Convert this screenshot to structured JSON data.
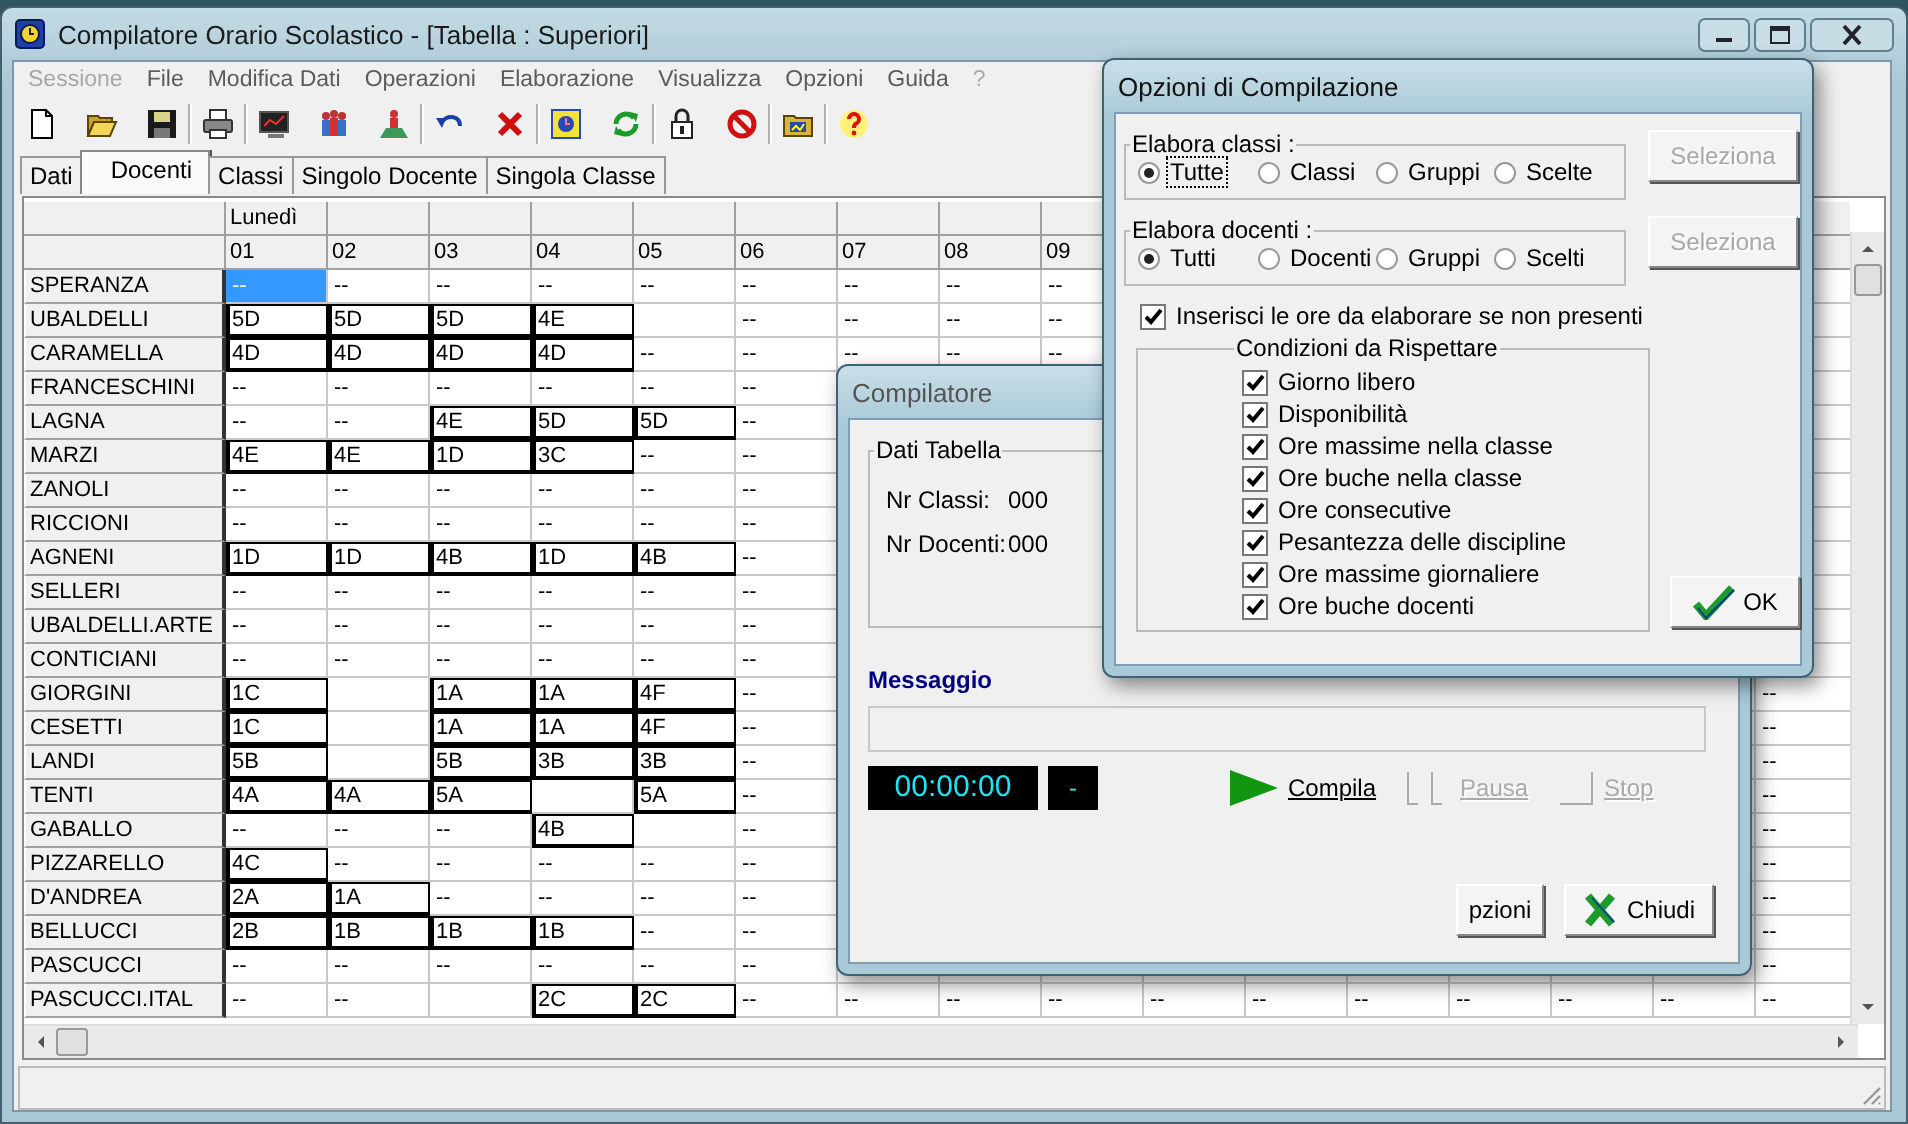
{
  "window": {
    "title": "Compilatore Orario Scolastico - [Tabella : Superiori]",
    "menu": [
      {
        "label": "Sessione",
        "disabled": true
      },
      {
        "label": "File",
        "disabled": false
      },
      {
        "label": "Modifica Dati",
        "disabled": false
      },
      {
        "label": "Operazioni",
        "disabled": false
      },
      {
        "label": "Elaborazione",
        "disabled": false
      },
      {
        "label": "Visualizza",
        "disabled": false
      },
      {
        "label": "Opzioni",
        "disabled": false
      },
      {
        "label": "Guida",
        "disabled": false
      },
      {
        "label": "?",
        "disabled": true
      }
    ],
    "tabs": [
      {
        "label": "Dati",
        "selected": false
      },
      {
        "label": "Docenti",
        "selected": true
      },
      {
        "label": "Classi",
        "selected": false
      },
      {
        "label": "Singolo Docente",
        "selected": false
      },
      {
        "label": "Singola Classe",
        "selected": false
      }
    ]
  },
  "grid": {
    "day": "Lunedì",
    "hours": [
      "01",
      "02",
      "03",
      "04",
      "05",
      "06",
      "07",
      "08",
      "09"
    ],
    "rows": [
      {
        "name": "SPERANZA",
        "cells": [
          {
            "text": "--",
            "boxed": false,
            "selected": true
          },
          {
            "text": "--",
            "boxed": false,
            "selected": false
          },
          {
            "text": "--",
            "boxed": false,
            "selected": false
          },
          {
            "text": "--",
            "boxed": false,
            "selected": false
          },
          {
            "text": "--",
            "boxed": false,
            "selected": false
          },
          {
            "text": "--",
            "boxed": false,
            "selected": false
          },
          {
            "text": "--",
            "boxed": false,
            "selected": false
          },
          {
            "text": "--",
            "boxed": false,
            "selected": false
          },
          {
            "text": "--",
            "boxed": false,
            "selected": false
          }
        ]
      },
      {
        "name": "UBALDELLI",
        "cells": [
          {
            "text": "5D",
            "boxed": true,
            "selected": false
          },
          {
            "text": "5D",
            "boxed": true,
            "selected": false
          },
          {
            "text": "5D",
            "boxed": true,
            "selected": false
          },
          {
            "text": "4E",
            "boxed": true,
            "selected": false
          },
          null,
          {
            "text": "--",
            "boxed": false,
            "selected": false
          },
          {
            "text": "--",
            "boxed": false,
            "selected": false
          },
          {
            "text": "--",
            "boxed": false,
            "selected": false
          },
          {
            "text": "--",
            "boxed": false,
            "selected": false
          }
        ]
      },
      {
        "name": "CARAMELLA",
        "cells": [
          {
            "text": "4D",
            "boxed": true,
            "selected": false
          },
          {
            "text": "4D",
            "boxed": true,
            "selected": false
          },
          {
            "text": "4D",
            "boxed": true,
            "selected": false
          },
          {
            "text": "4D",
            "boxed": true,
            "selected": false
          },
          {
            "text": "--",
            "boxed": false,
            "selected": false
          },
          {
            "text": "--",
            "boxed": false,
            "selected": false
          },
          {
            "text": "--",
            "boxed": false,
            "selected": false
          },
          {
            "text": "--",
            "boxed": false,
            "selected": false
          },
          {
            "text": "--",
            "boxed": false,
            "selected": false
          }
        ]
      },
      {
        "name": "FRANCESCHINI",
        "cells": [
          {
            "text": "--",
            "boxed": false,
            "selected": false
          },
          {
            "text": "--",
            "boxed": false,
            "selected": false
          },
          {
            "text": "--",
            "boxed": false,
            "selected": false
          },
          {
            "text": "--",
            "boxed": false,
            "selected": false
          },
          {
            "text": "--",
            "boxed": false,
            "selected": false
          },
          {
            "text": "--",
            "boxed": false,
            "selected": false
          }
        ]
      },
      {
        "name": "LAGNA",
        "cells": [
          {
            "text": "--",
            "boxed": false,
            "selected": false
          },
          {
            "text": "--",
            "boxed": false,
            "selected": false
          },
          {
            "text": "4E",
            "boxed": true,
            "selected": false
          },
          {
            "text": "5D",
            "boxed": true,
            "selected": false
          },
          {
            "text": "5D",
            "boxed": true,
            "selected": false
          },
          {
            "text": "--",
            "boxed": false,
            "selected": false
          }
        ]
      },
      {
        "name": "MARZI",
        "cells": [
          {
            "text": "4E",
            "boxed": true,
            "selected": false
          },
          {
            "text": "4E",
            "boxed": true,
            "selected": false
          },
          {
            "text": "1D",
            "boxed": true,
            "selected": false
          },
          {
            "text": "3C",
            "boxed": true,
            "selected": false
          },
          {
            "text": "--",
            "boxed": false,
            "selected": false
          },
          {
            "text": "--",
            "boxed": false,
            "selected": false
          }
        ]
      },
      {
        "name": "ZANOLI",
        "cells": [
          {
            "text": "--",
            "boxed": false,
            "selected": false
          },
          {
            "text": "--",
            "boxed": false,
            "selected": false
          },
          {
            "text": "--",
            "boxed": false,
            "selected": false
          },
          {
            "text": "--",
            "boxed": false,
            "selected": false
          },
          {
            "text": "--",
            "boxed": false,
            "selected": false
          },
          {
            "text": "--",
            "boxed": false,
            "selected": false
          }
        ]
      },
      {
        "name": "RICCIONI",
        "cells": [
          {
            "text": "--",
            "boxed": false,
            "selected": false
          },
          {
            "text": "--",
            "boxed": false,
            "selected": false
          },
          {
            "text": "--",
            "boxed": false,
            "selected": false
          },
          {
            "text": "--",
            "boxed": false,
            "selected": false
          },
          {
            "text": "--",
            "boxed": false,
            "selected": false
          },
          {
            "text": "--",
            "boxed": false,
            "selected": false
          }
        ]
      },
      {
        "name": "AGNENI",
        "cells": [
          {
            "text": "1D",
            "boxed": true,
            "selected": false
          },
          {
            "text": "1D",
            "boxed": true,
            "selected": false
          },
          {
            "text": "4B",
            "boxed": true,
            "selected": false
          },
          {
            "text": "1D",
            "boxed": true,
            "selected": false
          },
          {
            "text": "4B",
            "boxed": true,
            "selected": false
          },
          {
            "text": "--",
            "boxed": false,
            "selected": false
          }
        ]
      },
      {
        "name": "SELLERI",
        "cells": [
          {
            "text": "--",
            "boxed": false,
            "selected": false
          },
          {
            "text": "--",
            "boxed": false,
            "selected": false
          },
          {
            "text": "--",
            "boxed": false,
            "selected": false
          },
          {
            "text": "--",
            "boxed": false,
            "selected": false
          },
          {
            "text": "--",
            "boxed": false,
            "selected": false
          },
          {
            "text": "--",
            "boxed": false,
            "selected": false
          }
        ]
      },
      {
        "name": "UBALDELLI.ARTE",
        "cells": [
          {
            "text": "--",
            "boxed": false,
            "selected": false
          },
          {
            "text": "--",
            "boxed": false,
            "selected": false
          },
          {
            "text": "--",
            "boxed": false,
            "selected": false
          },
          {
            "text": "--",
            "boxed": false,
            "selected": false
          },
          {
            "text": "--",
            "boxed": false,
            "selected": false
          },
          {
            "text": "--",
            "boxed": false,
            "selected": false
          }
        ]
      },
      {
        "name": "CONTICIANI",
        "cells": [
          {
            "text": "--",
            "boxed": false,
            "selected": false
          },
          {
            "text": "--",
            "boxed": false,
            "selected": false
          },
          {
            "text": "--",
            "boxed": false,
            "selected": false
          },
          {
            "text": "--",
            "boxed": false,
            "selected": false
          },
          {
            "text": "--",
            "boxed": false,
            "selected": false
          },
          {
            "text": "--",
            "boxed": false,
            "selected": false
          }
        ]
      },
      {
        "name": "GIORGINI",
        "cells": [
          {
            "text": "1C",
            "boxed": true,
            "selected": false
          },
          null,
          {
            "text": "1A",
            "boxed": true,
            "selected": false
          },
          {
            "text": "1A",
            "boxed": true,
            "selected": false
          },
          {
            "text": "4F",
            "boxed": true,
            "selected": false
          },
          {
            "text": "--",
            "boxed": false,
            "selected": false
          },
          null,
          null,
          null,
          null,
          null,
          null,
          null,
          null,
          null,
          {
            "text": "--",
            "boxed": false,
            "selected": false
          }
        ]
      },
      {
        "name": "CESETTI",
        "cells": [
          {
            "text": "1C",
            "boxed": true,
            "selected": false
          },
          null,
          {
            "text": "1A",
            "boxed": true,
            "selected": false
          },
          {
            "text": "1A",
            "boxed": true,
            "selected": false
          },
          {
            "text": "4F",
            "boxed": true,
            "selected": false
          },
          {
            "text": "--",
            "boxed": false,
            "selected": false
          },
          null,
          null,
          null,
          null,
          null,
          null,
          null,
          null,
          null,
          {
            "text": "--",
            "boxed": false,
            "selected": false
          }
        ]
      },
      {
        "name": "LANDI",
        "cells": [
          {
            "text": "5B",
            "boxed": true,
            "selected": false
          },
          null,
          {
            "text": "5B",
            "boxed": true,
            "selected": false
          },
          {
            "text": "3B",
            "boxed": true,
            "selected": false
          },
          {
            "text": "3B",
            "boxed": true,
            "selected": false
          },
          {
            "text": "--",
            "boxed": false,
            "selected": false
          },
          null,
          null,
          null,
          null,
          null,
          null,
          null,
          null,
          null,
          {
            "text": "--",
            "boxed": false,
            "selected": false
          }
        ]
      },
      {
        "name": "TENTI",
        "cells": [
          {
            "text": "4A",
            "boxed": true,
            "selected": false
          },
          {
            "text": "4A",
            "boxed": true,
            "selected": false
          },
          {
            "text": "5A",
            "boxed": true,
            "selected": false
          },
          null,
          {
            "text": "5A",
            "boxed": true,
            "selected": false
          },
          {
            "text": "--",
            "boxed": false,
            "selected": false
          },
          null,
          null,
          null,
          null,
          null,
          null,
          null,
          null,
          null,
          {
            "text": "--",
            "boxed": false,
            "selected": false
          }
        ]
      },
      {
        "name": "GABALLO",
        "cells": [
          {
            "text": "--",
            "boxed": false,
            "selected": false
          },
          {
            "text": "--",
            "boxed": false,
            "selected": false
          },
          {
            "text": "--",
            "boxed": false,
            "selected": false
          },
          {
            "text": "4B",
            "boxed": true,
            "selected": false
          },
          null,
          {
            "text": "--",
            "boxed": false,
            "selected": false
          },
          null,
          null,
          null,
          null,
          null,
          null,
          null,
          null,
          null,
          {
            "text": "--",
            "boxed": false,
            "selected": false
          }
        ]
      },
      {
        "name": "PIZZARELLO",
        "cells": [
          {
            "text": "4C",
            "boxed": true,
            "selected": false
          },
          {
            "text": "--",
            "boxed": false,
            "selected": false
          },
          {
            "text": "--",
            "boxed": false,
            "selected": false
          },
          {
            "text": "--",
            "boxed": false,
            "selected": false
          },
          {
            "text": "--",
            "boxed": false,
            "selected": false
          },
          {
            "text": "--",
            "boxed": false,
            "selected": false
          },
          null,
          null,
          null,
          null,
          null,
          null,
          null,
          null,
          null,
          {
            "text": "--",
            "boxed": false,
            "selected": false
          }
        ]
      },
      {
        "name": "D'ANDREA",
        "cells": [
          {
            "text": "2A",
            "boxed": true,
            "selected": false
          },
          {
            "text": "1A",
            "boxed": true,
            "selected": false
          },
          {
            "text": "--",
            "boxed": false,
            "selected": false
          },
          {
            "text": "--",
            "boxed": false,
            "selected": false
          },
          {
            "text": "--",
            "boxed": false,
            "selected": false
          },
          {
            "text": "--",
            "boxed": false,
            "selected": false
          },
          null,
          null,
          null,
          null,
          null,
          null,
          null,
          null,
          null,
          {
            "text": "--",
            "boxed": false,
            "selected": false
          }
        ]
      },
      {
        "name": "BELLUCCI",
        "cells": [
          {
            "text": "2B",
            "boxed": true,
            "selected": false
          },
          {
            "text": "1B",
            "boxed": true,
            "selected": false
          },
          {
            "text": "1B",
            "boxed": true,
            "selected": false
          },
          {
            "text": "1B",
            "boxed": true,
            "selected": false
          },
          {
            "text": "--",
            "boxed": false,
            "selected": false
          },
          {
            "text": "--",
            "boxed": false,
            "selected": false
          },
          null,
          null,
          null,
          null,
          null,
          null,
          null,
          null,
          null,
          {
            "text": "--",
            "boxed": false,
            "selected": false
          }
        ]
      },
      {
        "name": "PASCUCCI",
        "cells": [
          {
            "text": "--",
            "boxed": false,
            "selected": false
          },
          {
            "text": "--",
            "boxed": false,
            "selected": false
          },
          {
            "text": "--",
            "boxed": false,
            "selected": false
          },
          {
            "text": "--",
            "boxed": false,
            "selected": false
          },
          {
            "text": "--",
            "boxed": false,
            "selected": false
          },
          {
            "text": "--",
            "boxed": false,
            "selected": false
          },
          null,
          null,
          null,
          null,
          null,
          null,
          null,
          null,
          null,
          {
            "text": "--",
            "boxed": false,
            "selected": false
          }
        ]
      },
      {
        "name": "PASCUCCI.ITAL",
        "cells": [
          {
            "text": "--",
            "boxed": false,
            "selected": false
          },
          {
            "text": "--",
            "boxed": false,
            "selected": false
          },
          null,
          {
            "text": "2C",
            "boxed": true,
            "selected": false
          },
          {
            "text": "2C",
            "boxed": true,
            "selected": false
          },
          {
            "text": "--",
            "boxed": false,
            "selected": false
          },
          {
            "text": "--",
            "boxed": false,
            "selected": false
          },
          {
            "text": "--",
            "boxed": false,
            "selected": false
          },
          {
            "text": "--",
            "boxed": false,
            "selected": false
          },
          {
            "text": "--",
            "boxed": false,
            "selected": false
          },
          {
            "text": "--",
            "boxed": false,
            "selected": false
          },
          {
            "text": "--",
            "boxed": false,
            "selected": false
          },
          {
            "text": "--",
            "boxed": false,
            "selected": false
          },
          {
            "text": "--",
            "boxed": false,
            "selected": false
          },
          {
            "text": "--",
            "boxed": false,
            "selected": false
          },
          {
            "text": "--",
            "boxed": false,
            "selected": false
          }
        ]
      }
    ]
  },
  "compiler_dialog": {
    "title": "Compilatore",
    "data_group": {
      "title": "Dati Tabella",
      "fields": [
        {
          "label": "Nr Classi:",
          "value": "000"
        },
        {
          "label": "Nr Docenti:",
          "value": "000"
        }
      ]
    },
    "message_label": "Messaggio",
    "timer": "00:00:00",
    "status": "-",
    "actions": [
      {
        "kind": "play",
        "label": "Compila",
        "disabled": false
      },
      {
        "kind": "pause",
        "label": "Pausa",
        "disabled": true
      },
      {
        "kind": "stop",
        "label": "Stop",
        "disabled": true
      }
    ],
    "buttons": [
      {
        "kind": "options",
        "label": "pzioni"
      },
      {
        "kind": "close",
        "label": "Chiudi"
      }
    ]
  },
  "options_dialog": {
    "title": "Opzioni di Compilazione",
    "groups": [
      {
        "label": "Elabora classi :",
        "options": [
          {
            "label": "Tutte",
            "selected": true,
            "focused": true
          },
          {
            "label": "Classi",
            "selected": false,
            "focused": false
          },
          {
            "label": "Gruppi",
            "selected": false,
            "focused": false
          },
          {
            "label": "Scelte",
            "selected": false,
            "focused": false
          }
        ],
        "button": {
          "label": "Seleziona",
          "disabled": true
        }
      },
      {
        "label": "Elabora docenti :",
        "options": [
          {
            "label": "Tutti",
            "selected": true,
            "focused": false
          },
          {
            "label": "Docenti",
            "selected": false,
            "focused": false
          },
          {
            "label": "Gruppi",
            "selected": false,
            "focused": false
          },
          {
            "label": "Scelti",
            "selected": false,
            "focused": false
          }
        ],
        "button": {
          "label": "Seleziona",
          "disabled": true
        }
      }
    ],
    "insert_hours": {
      "label": "Inserisci le ore da elaborare se non presenti",
      "checked": true
    },
    "conditions": {
      "title": "Condizioni da Rispettare",
      "items": [
        {
          "label": "Giorno libero",
          "checked": true
        },
        {
          "label": "Disponibilità",
          "checked": true
        },
        {
          "label": "Ore massime nella classe",
          "checked": true
        },
        {
          "label": "Ore buche nella classe",
          "checked": true
        },
        {
          "label": "Ore consecutive",
          "checked": true
        },
        {
          "label": "Pesantezza delle discipline",
          "checked": true
        },
        {
          "label": "Ore massime giornaliere",
          "checked": true
        },
        {
          "label": "Ore buche docenti",
          "checked": true
        }
      ]
    },
    "ok_button": "OK"
  }
}
